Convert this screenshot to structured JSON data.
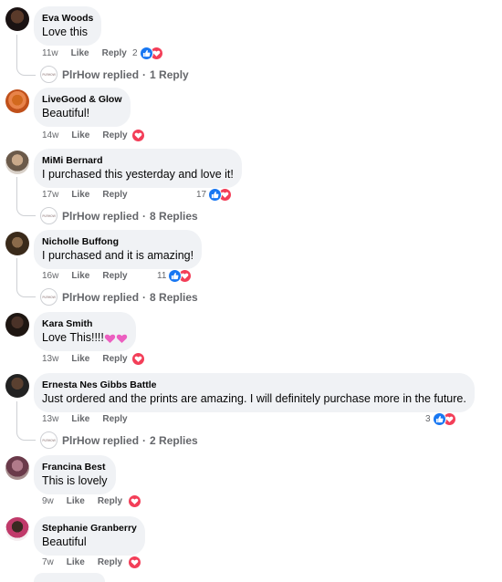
{
  "reply_label": "Reply",
  "like_label": "Like",
  "reply_dot": "·",
  "comments": [
    {
      "name": "Eva Woods",
      "text": "Love this",
      "time": "11w",
      "reactions": "2",
      "replied_by": "PlrHow replied",
      "reply_count": "1 Reply"
    },
    {
      "name": "LiveGood & Glow",
      "text": "Beautiful!",
      "time": "14w"
    },
    {
      "name": "MiMi Bernard",
      "text": "I purchased this yesterday and love it!",
      "time": "17w",
      "reactions": "17",
      "replied_by": "PlrHow replied",
      "reply_count": "8 Replies"
    },
    {
      "name": "Nicholle Buffong",
      "text": "I purchased and it is amazing!",
      "time": "16w",
      "reactions": "11",
      "replied_by": "PlrHow replied",
      "reply_count": "8 Replies"
    },
    {
      "name": "Kara Smith",
      "text": "Love This!!!!",
      "time": "13w"
    },
    {
      "name": "Ernesta Nes Gibbs Battle",
      "text": "Just ordered and the prints are amazing. I will definitely purchase more in the future.",
      "time": "13w",
      "reactions": "3",
      "replied_by": "PlrHow replied",
      "reply_count": "2 Replies"
    },
    {
      "name": "Francina Best",
      "text": "This is lovely",
      "time": "9w"
    },
    {
      "name": "Stephanie Granberry",
      "text": "Beautiful",
      "time": "7w"
    }
  ],
  "colors": {
    "like": "#1877f2",
    "love": "#f33e58",
    "meta": "#65676b",
    "bubble": "#f0f2f5"
  }
}
